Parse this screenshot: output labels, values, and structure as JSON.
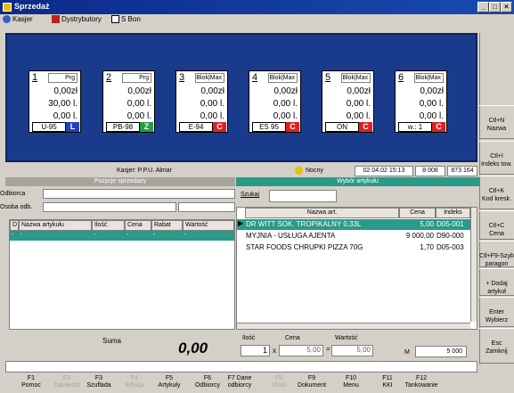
{
  "window": {
    "title": "Sprzedaż"
  },
  "menu": [
    "Kasjer",
    "Dystrybutory",
    "S Bon"
  ],
  "pumps": [
    {
      "num": "1",
      "type": "Prg",
      "amount": "0,00zł",
      "liters": "30,00 l.",
      "liters2": "0,00 l.",
      "fuel": "U-95",
      "status": "L",
      "status_color": "#2040c0"
    },
    {
      "num": "2",
      "type": "Prg",
      "amount": "0,00zł",
      "liters": "0,00 l.",
      "liters2": "0,00 l.",
      "fuel": "PB-98",
      "status": "Z",
      "status_color": "#20a040"
    },
    {
      "num": "3",
      "type": "Blok|Max",
      "amount": "0,00zł",
      "liters": "0,00 l.",
      "liters2": "0,00 l.",
      "fuel": "E-94",
      "status": "C",
      "status_color": "#e02020"
    },
    {
      "num": "4",
      "type": "Blok|Max",
      "amount": "0,00zł",
      "liters": "0,00 l.",
      "liters2": "0,00 l.",
      "fuel": "ES 95",
      "status": "C",
      "status_color": "#e02020"
    },
    {
      "num": "5",
      "type": "Blok|Max",
      "amount": "0,00zł",
      "liters": "0,00 l.",
      "liters2": "0,00 l.",
      "fuel": "ON",
      "status": "C",
      "status_color": "#e02020"
    },
    {
      "num": "6",
      "type": "Blok|Max",
      "amount": "0,00zł",
      "liters": "0,00 l.",
      "liters2": "0,00 l.",
      "fuel": "w.: 1",
      "status": "C",
      "status_color": "#e02020"
    }
  ],
  "status": {
    "cashier": "Kasjer: P.P.U. Almar",
    "shift": "Nocny",
    "datetime": "02.04.02 15:13",
    "n1": "8 008",
    "n2": "873 164"
  },
  "left": {
    "title": "Pozycje sprzedaży",
    "odbiorca": "Odbiorca",
    "osoba": "Osoba odb.",
    "cols": [
      "D",
      "Nazwa artykułu",
      "Ilość",
      "Cena",
      "Rabat",
      "Wartość"
    ],
    "row": [
      "-",
      "-",
      "-",
      "-",
      "-",
      "-"
    ]
  },
  "right": {
    "title": "Wybór artykułu",
    "search_label": "Szukaj",
    "cols": [
      "Nazwa art.",
      "Cena",
      "Indeks"
    ],
    "rows": [
      {
        "name": "DR WITT SOK. TROPIKALNY 0,33L",
        "price": "5,00",
        "index": "D05-001"
      },
      {
        "name": "MYJNIA - USŁUGA AJENTA",
        "price": "9 000,00",
        "index": "D90-000"
      },
      {
        "name": "STAR FOODS CHRUPKI PIZZA 70G",
        "price": "1,70",
        "index": "D05-003"
      }
    ]
  },
  "sum": {
    "label": "Suma",
    "value": "0,00"
  },
  "qty": {
    "ilosc_label": "Ilość",
    "cena_label": "Cena",
    "wartosc_label": "Wartość",
    "ilosc": "1",
    "x": "x",
    "cena": "5,00",
    "eq": "=",
    "wartosc": "5,00",
    "m_label": "M",
    "m_value": "5 000"
  },
  "side": [
    {
      "l1": "Ctl+N",
      "l2": "Nazwa"
    },
    {
      "l1": "Ctl+I",
      "l2": "Indeks tow."
    },
    {
      "l1": "Ctl+K",
      "l2": "Kod kresk."
    },
    {
      "l1": "Ctl+C",
      "l2": "Cena"
    },
    {
      "l1": "Ctl+F9-Szyb",
      "l2": "paragon"
    },
    {
      "l1": "+ Dodaj",
      "l2": "artykuł"
    },
    {
      "l1": "Enter",
      "l2": "Wybierz"
    },
    {
      "l1": "Esc",
      "l2": "Zamknij"
    }
  ],
  "fkeys": [
    {
      "k": "F1",
      "l": "Pomoc",
      "dis": false
    },
    {
      "k": "F2",
      "l": "Zatwierdź",
      "dis": true
    },
    {
      "k": "F3",
      "l": "Szuflada",
      "dis": false
    },
    {
      "k": "F4",
      "l": "Edycja",
      "dis": true
    },
    {
      "k": "F5",
      "l": "Artykuły",
      "dis": false
    },
    {
      "k": "F6",
      "l": "Odbiorcy",
      "dis": false
    },
    {
      "k": "F7 Dane",
      "l": "odbiorcy",
      "dis": false
    },
    {
      "k": "F8",
      "l": "Usuń",
      "dis": true
    },
    {
      "k": "F9",
      "l": "Dokument",
      "dis": false
    },
    {
      "k": "F10",
      "l": "Menu",
      "dis": false
    },
    {
      "k": "F11",
      "l": "KKI",
      "dis": false
    },
    {
      "k": "F12",
      "l": "Tankowanie",
      "dis": false
    }
  ]
}
